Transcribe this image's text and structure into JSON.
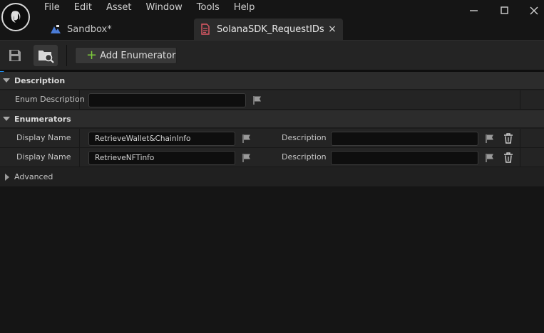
{
  "menu": [
    "File",
    "Edit",
    "Asset",
    "Window",
    "Tools",
    "Help"
  ],
  "tabs": [
    {
      "label": "Sandbox*",
      "icon": "level-icon",
      "active": false
    },
    {
      "label": "SolanaSDK_RequestIDs",
      "icon": "enum-asset-icon",
      "active": true,
      "close": "×"
    }
  ],
  "toolbar": {
    "save_icon": "save-icon",
    "browse_icon": "browse-icon",
    "add_enumerator_label": "Add Enumerator"
  },
  "details": {
    "description_category": "Description",
    "enum_description_label": "Enum Description",
    "enum_description_value": "",
    "enumerators_category": "Enumerators",
    "enumerators": [
      {
        "display_name_label": "Display Name",
        "display_name": "RetrieveWallet&ChainInfo",
        "description_label": "Description",
        "description": ""
      },
      {
        "display_name_label": "Display Name",
        "display_name": "RetrieveNFTinfo",
        "description_label": "Description",
        "description": ""
      }
    ],
    "advanced_label": "Advanced"
  },
  "colors": {
    "accent": "#1e8ef0",
    "add_plus": "#7ecb3c",
    "background": "#151515",
    "panel": "#242424"
  }
}
